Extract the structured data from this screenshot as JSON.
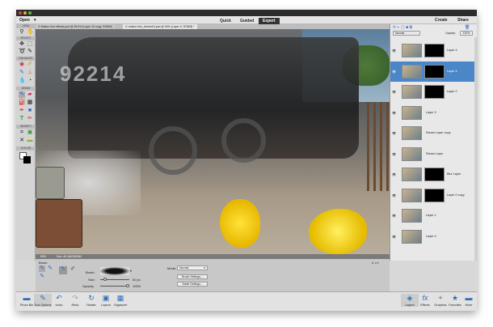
{
  "menubar": {
    "open": "Open",
    "modes": [
      "Quick",
      "Guided",
      "Expert"
    ],
    "create": "Create",
    "share": "Share"
  },
  "tabs": [
    "G Motion blur effects.psd @ 28.6% (Layer 10 copy, RGB/8)",
    "G motion blur_before04.psd @ 50% (Layer 5, RGB/8) *"
  ],
  "toolbox": {
    "sections": [
      "VIEW",
      "SELECT",
      "ENHANCE",
      "DRAW",
      "MODIFY",
      "COLOR"
    ]
  },
  "canvas": {
    "plate": "92214"
  },
  "status": {
    "zoom": "50%",
    "doc": "Doc: 40.1M/208.8M"
  },
  "options": {
    "section": "Brush",
    "brush_label": "Brush:",
    "size_label": "Size:",
    "size_value": "50 px",
    "size_fraction": 0.12,
    "opacity_label": "Opacity:",
    "opacity_value": "100%",
    "opacity_fraction": 1.0,
    "mode_label": "Mode:",
    "mode_value": "Normal",
    "brush_settings": "Brush Settings...",
    "tablet_settings": "Tablet Settings..."
  },
  "taskbar": {
    "left": [
      "Photo Bin",
      "Tool Options",
      "Undo",
      "Redo",
      "Rotate",
      "Layout",
      "Organizer"
    ],
    "right": [
      "Layers",
      "Effects",
      "Graphics",
      "Favorites",
      "More"
    ]
  },
  "layers_panel": {
    "blend": "Normal",
    "opacity_label": "Opacity:",
    "opacity": "100%",
    "layers": [
      {
        "name": "Layer 4",
        "mask": true,
        "selected": false
      },
      {
        "name": "Layer 5",
        "mask": true,
        "selected": true
      },
      {
        "name": "Layer 2",
        "mask": true,
        "selected": false
      },
      {
        "name": "Layer 3",
        "mask": false,
        "selected": false
      },
      {
        "name": "Steam Layer copy",
        "mask": false,
        "selected": false
      },
      {
        "name": "Steam Layer",
        "mask": false,
        "selected": false
      },
      {
        "name": "Blur Layer",
        "mask": true,
        "selected": false
      },
      {
        "name": "Layer 0 copy",
        "mask": true,
        "selected": false
      },
      {
        "name": "Layer 1",
        "mask": false,
        "selected": false
      },
      {
        "name": "Layer 0",
        "mask": false,
        "selected": false
      }
    ]
  }
}
